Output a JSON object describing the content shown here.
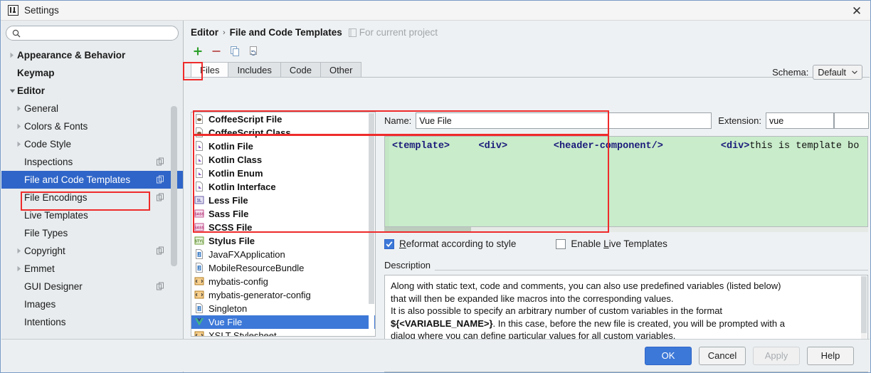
{
  "window": {
    "title": "Settings",
    "logo_icon": "intellij-idea-logo-icon",
    "close_icon": "close-icon"
  },
  "search": {
    "value": "",
    "placeholder": "",
    "icon": "search-icon"
  },
  "sidebar": {
    "scrollbar": "sidebar-scrollbar",
    "items": [
      {
        "label": "Appearance & Behavior",
        "level": 0,
        "bold": true,
        "arrow": "collapsed",
        "selected": false,
        "copy_icon": false
      },
      {
        "label": "Keymap",
        "level": 0,
        "bold": true,
        "arrow": "none",
        "selected": false,
        "copy_icon": false
      },
      {
        "label": "Editor",
        "level": 0,
        "bold": true,
        "arrow": "expanded",
        "selected": false,
        "copy_icon": false
      },
      {
        "label": "General",
        "level": 1,
        "bold": false,
        "arrow": "collapsed",
        "selected": false,
        "copy_icon": false
      },
      {
        "label": "Colors & Fonts",
        "level": 1,
        "bold": false,
        "arrow": "collapsed",
        "selected": false,
        "copy_icon": false
      },
      {
        "label": "Code Style",
        "level": 1,
        "bold": false,
        "arrow": "collapsed",
        "selected": false,
        "copy_icon": false
      },
      {
        "label": "Inspections",
        "level": 1,
        "bold": false,
        "arrow": "none",
        "selected": false,
        "copy_icon": true
      },
      {
        "label": "File and Code Templates",
        "level": 1,
        "bold": false,
        "arrow": "none",
        "selected": true,
        "copy_icon": true
      },
      {
        "label": "File Encodings",
        "level": 1,
        "bold": false,
        "arrow": "none",
        "selected": false,
        "copy_icon": true
      },
      {
        "label": "Live Templates",
        "level": 1,
        "bold": false,
        "arrow": "none",
        "selected": false,
        "copy_icon": false
      },
      {
        "label": "File Types",
        "level": 1,
        "bold": false,
        "arrow": "none",
        "selected": false,
        "copy_icon": false
      },
      {
        "label": "Copyright",
        "level": 1,
        "bold": false,
        "arrow": "collapsed",
        "selected": false,
        "copy_icon": true
      },
      {
        "label": "Emmet",
        "level": 1,
        "bold": false,
        "arrow": "collapsed",
        "selected": false,
        "copy_icon": false
      },
      {
        "label": "GUI Designer",
        "level": 1,
        "bold": false,
        "arrow": "none",
        "selected": false,
        "copy_icon": true
      },
      {
        "label": "Images",
        "level": 1,
        "bold": false,
        "arrow": "none",
        "selected": false,
        "copy_icon": false
      },
      {
        "label": "Intentions",
        "level": 1,
        "bold": false,
        "arrow": "none",
        "selected": false,
        "copy_icon": false
      }
    ]
  },
  "breadcrumb": {
    "parent": "Editor",
    "separator": "›",
    "current": "File and Code Templates",
    "scope_note": "For current project",
    "scope_icon": "project-scope-icon"
  },
  "toolbar": {
    "buttons": [
      {
        "name": "add-template-button",
        "icon": "plus-icon",
        "highlighted": true
      },
      {
        "name": "remove-template-button",
        "icon": "minus-icon",
        "highlighted": false
      },
      {
        "name": "copy-template-button",
        "icon": "copy-icon",
        "highlighted": false
      },
      {
        "name": "reset-to-default-button",
        "icon": "reset-page-icon",
        "highlighted": false
      }
    ]
  },
  "schema": {
    "label": "Schema:",
    "value": "Default",
    "dropdown_icon": "chevron-down-icon"
  },
  "tabs": [
    {
      "label": "Files",
      "active": true
    },
    {
      "label": "Includes",
      "active": false
    },
    {
      "label": "Code",
      "active": false
    },
    {
      "label": "Other",
      "active": false
    }
  ],
  "template_list": [
    {
      "label": "CoffeeScript File",
      "icon": "coffeescript-file-icon",
      "bold": true,
      "selected": false
    },
    {
      "label": "CoffeeScript Class",
      "icon": "coffeescript-file-icon",
      "bold": true,
      "selected": false
    },
    {
      "label": "Kotlin File",
      "icon": "kotlin-file-icon",
      "bold": true,
      "selected": false
    },
    {
      "label": "Kotlin Class",
      "icon": "kotlin-file-icon",
      "bold": true,
      "selected": false
    },
    {
      "label": "Kotlin Enum",
      "icon": "kotlin-file-icon",
      "bold": true,
      "selected": false
    },
    {
      "label": "Kotlin Interface",
      "icon": "kotlin-file-icon",
      "bold": true,
      "selected": false
    },
    {
      "label": "Less File",
      "icon": "less-file-icon",
      "bold": true,
      "selected": false
    },
    {
      "label": "Sass File",
      "icon": "sass-file-icon",
      "bold": true,
      "selected": false
    },
    {
      "label": "SCSS File",
      "icon": "scss-file-icon",
      "bold": true,
      "selected": false
    },
    {
      "label": "Stylus File",
      "icon": "stylus-file-icon",
      "bold": true,
      "selected": false
    },
    {
      "label": "JavaFXApplication",
      "icon": "java-file-icon",
      "bold": false,
      "selected": false
    },
    {
      "label": "MobileResourceBundle",
      "icon": "java-file-icon",
      "bold": false,
      "selected": false
    },
    {
      "label": "mybatis-config",
      "icon": "xml-file-icon",
      "bold": false,
      "selected": false
    },
    {
      "label": "mybatis-generator-config",
      "icon": "xml-file-icon",
      "bold": false,
      "selected": false
    },
    {
      "label": "Singleton",
      "icon": "java-file-icon",
      "bold": false,
      "selected": false
    },
    {
      "label": "Vue File",
      "icon": "vue-file-icon",
      "bold": false,
      "selected": true
    },
    {
      "label": "XSLT Stylesheet",
      "icon": "xml-file-icon",
      "bold": false,
      "selected": false
    }
  ],
  "detail": {
    "name_label": "Name:",
    "name_value": "Vue File",
    "extension_label": "Extension:",
    "extension_value": "vue",
    "template_code": "<template>     <div>        <header-component/>          <div>this is template bo",
    "reformat_checkbox": {
      "label": "Reformat according to style",
      "checked": true,
      "mnemonic": "R"
    },
    "live_templates_checkbox": {
      "label": "Enable Live Templates",
      "checked": false,
      "mnemonic": "L"
    },
    "description_label": "Description",
    "description_lines": [
      "Along with static text, code and comments, you can also use predefined variables (listed below)",
      "that will then be expanded like macros into the corresponding values.",
      "It is also possible to specify an arbitrary number of custom variables in the format",
      "${<VARIABLE_NAME>}. In this case, before the new file is created, you will be prompted with a",
      "dialog where you can define particular values for all custom variables."
    ],
    "description_bold_prefix": "${<VARIABLE_NAME>}",
    "description_bold_rest": ". In this case, before the new file is created, you will be prompted with a"
  },
  "footer": {
    "ok": "OK",
    "cancel": "Cancel",
    "apply": "Apply",
    "help": "Help"
  },
  "colors": {
    "selection_blue": "#3c78d8",
    "highlight_red": "#ef2b2b",
    "editor_green": "#c9ecca",
    "accent_plus_green": "#2aa02a"
  }
}
